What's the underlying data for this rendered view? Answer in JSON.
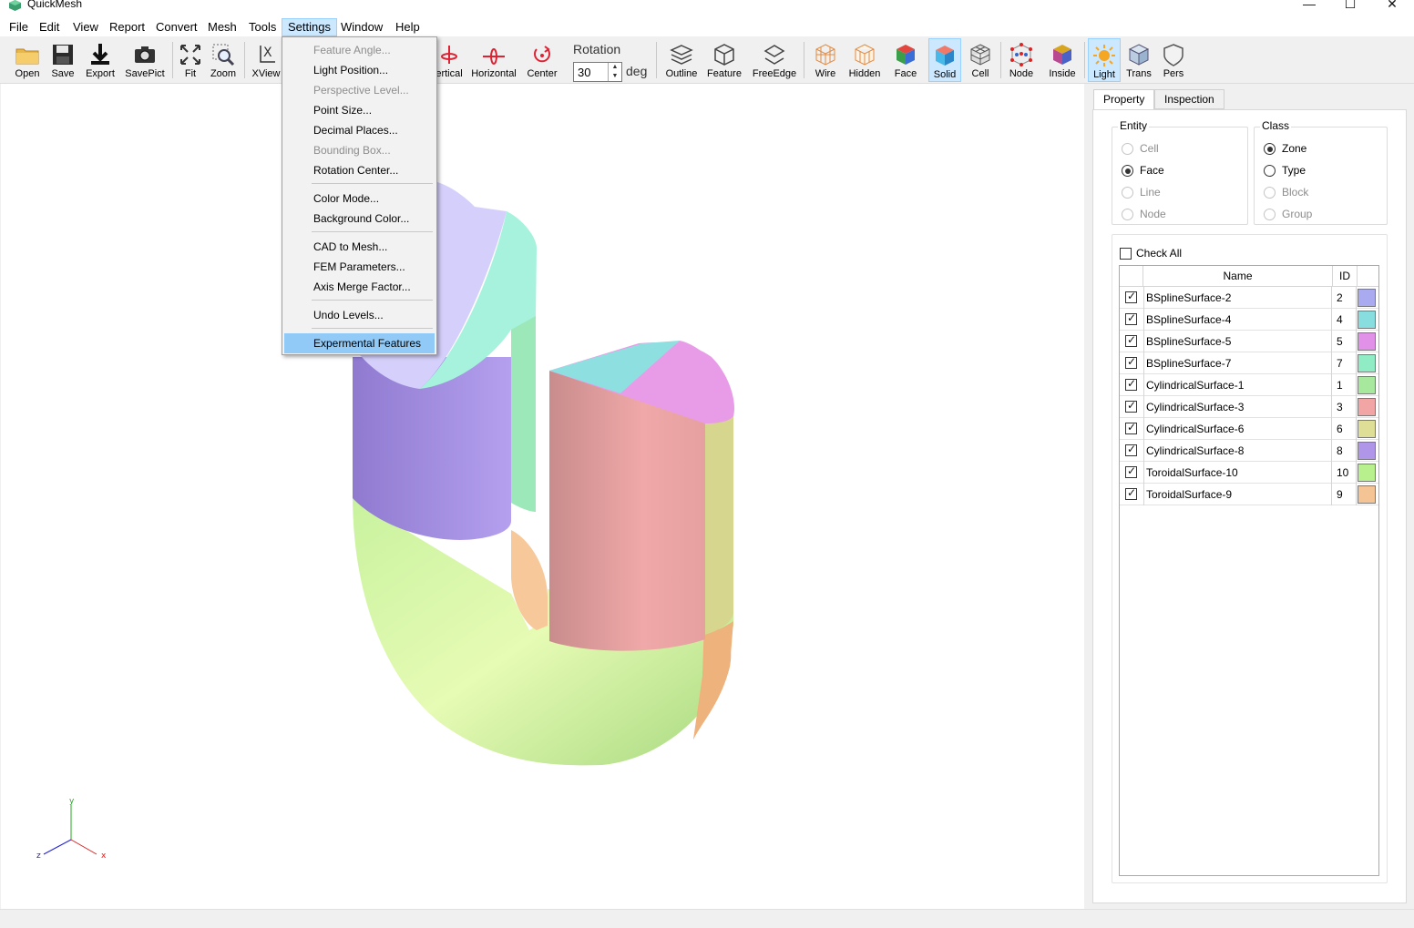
{
  "window": {
    "title": "QuickMesh",
    "minimize": "—",
    "maximize": "☐",
    "close": "✕"
  },
  "menubar": [
    "File",
    "Edit",
    "View",
    "Report",
    "Convert",
    "Mesh",
    "Tools",
    "Settings",
    "Window",
    "Help"
  ],
  "toolbar": {
    "left": [
      "Open",
      "Save",
      "Export",
      "SavePict",
      "Fit",
      "Zoom",
      "XView"
    ],
    "vertical": "ertical",
    "horizontal": "Horizontal",
    "center": "Center",
    "rotation_label": "Rotation",
    "rotation_value": "30",
    "deg": "deg",
    "display": [
      "Outline",
      "Feature",
      "FreeEdge",
      "Wire",
      "Hidden",
      "Face",
      "Solid",
      "Cell",
      "Node",
      "Inside",
      "Light",
      "Trans",
      "Pers"
    ]
  },
  "settings_menu": {
    "items": [
      {
        "label": "Feature Angle...",
        "enabled": false
      },
      {
        "label": "Light Position...",
        "enabled": true
      },
      {
        "label": "Perspective Level...",
        "enabled": false
      },
      {
        "label": "Point Size...",
        "enabled": true
      },
      {
        "label": "Decimal Places...",
        "enabled": true
      },
      {
        "label": "Bounding Box...",
        "enabled": false
      },
      {
        "label": "Rotation Center...",
        "enabled": true
      },
      {
        "label": "Color Mode...",
        "enabled": true
      },
      {
        "label": "Background Color...",
        "enabled": true
      },
      {
        "label": "CAD to Mesh...",
        "enabled": true
      },
      {
        "label": "FEM Parameters...",
        "enabled": true
      },
      {
        "label": "Axis Merge Factor...",
        "enabled": true
      },
      {
        "label": "Undo Levels...",
        "enabled": true
      },
      {
        "label": "Expermental Features",
        "enabled": true,
        "highlighted": true
      }
    ]
  },
  "axes": {
    "y": "y",
    "x": "x",
    "z": "z"
  },
  "panel": {
    "tabs": [
      "Property",
      "Inspection"
    ],
    "entity": {
      "title": "Entity",
      "options": [
        {
          "label": "Cell",
          "checked": false,
          "enabled": false
        },
        {
          "label": "Face",
          "checked": true,
          "enabled": true
        },
        {
          "label": "Line",
          "checked": false,
          "enabled": false
        },
        {
          "label": "Node",
          "checked": false,
          "enabled": false
        }
      ]
    },
    "class": {
      "title": "Class",
      "options": [
        {
          "label": "Zone",
          "checked": true,
          "enabled": true
        },
        {
          "label": "Type",
          "checked": false,
          "enabled": true
        },
        {
          "label": "Block",
          "checked": false,
          "enabled": false
        },
        {
          "label": "Group",
          "checked": false,
          "enabled": false
        }
      ]
    },
    "check_all": "Check All",
    "columns": {
      "name": "Name",
      "id": "ID"
    },
    "rows": [
      {
        "name": "BSplineSurface-2",
        "id": "2",
        "color": "#aaaaf0"
      },
      {
        "name": "BSplineSurface-4",
        "id": "4",
        "color": "#88dede"
      },
      {
        "name": "BSplineSurface-5",
        "id": "5",
        "color": "#e191e8"
      },
      {
        "name": "BSplineSurface-7",
        "id": "7",
        "color": "#8fecc4"
      },
      {
        "name": "CylindricalSurface-1",
        "id": "1",
        "color": "#a8e89e"
      },
      {
        "name": "CylindricalSurface-3",
        "id": "3",
        "color": "#f2a5a5"
      },
      {
        "name": "CylindricalSurface-6",
        "id": "6",
        "color": "#dede96"
      },
      {
        "name": "CylindricalSurface-8",
        "id": "8",
        "color": "#b096e8"
      },
      {
        "name": "ToroidalSurface-10",
        "id": "10",
        "color": "#b8f08e"
      },
      {
        "name": "ToroidalSurface-9",
        "id": "9",
        "color": "#f5c494"
      }
    ]
  }
}
